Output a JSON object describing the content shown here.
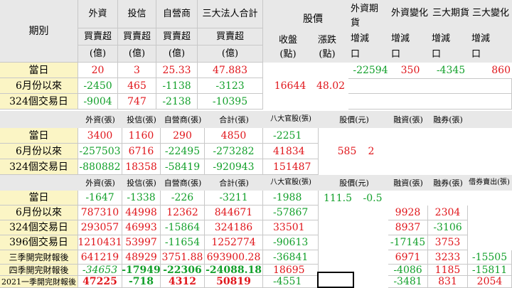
{
  "section1": {
    "header": {
      "period": "期別",
      "foreign": "外資",
      "trust": "投信",
      "dealer": "自營商",
      "total3": "三大法人合計",
      "net_label": "買賣超",
      "unit_label": "(億)",
      "price": "股價",
      "close": "收盤",
      "close_unit": "(點)",
      "change": "漲跌",
      "change_unit": "(點)",
      "fut_foreign_l1": "外資期",
      "fut_foreign_l2": "貨",
      "fut_foreign_change": "外資變化",
      "fut_three": "三大期貨",
      "fut_three_change": "三大變化",
      "incdec": "增減",
      "kou": "口"
    },
    "rows": [
      {
        "label": "當日",
        "foreign": "20",
        "trust": "3",
        "dealer": "25.33",
        "total": "47.883"
      },
      {
        "label": "6月份以來",
        "foreign": "-2450",
        "trust": "465",
        "dealer": "-1138",
        "total": "-3123"
      },
      {
        "label": "324個交易日",
        "foreign": "-9004",
        "trust": "747",
        "dealer": "-2138",
        "total": "-10395"
      }
    ],
    "close_value": "16644",
    "change_value": "48.02",
    "futures": {
      "foreign": "-22594",
      "foreign_change": "350",
      "three": "-4345",
      "three_change": "860"
    }
  },
  "section2": {
    "header": {
      "foreign": "外資(張)",
      "trust": "投信(張)",
      "dealer": "自營商(張)",
      "total": "合計(張)",
      "eight": "八大官股(張)",
      "price": "股價(元)",
      "margin": "融資(張)",
      "short": "融券(張)"
    },
    "rows": [
      {
        "label": "當日",
        "foreign": "3400",
        "trust": "1160",
        "dealer": "290",
        "total": "4850",
        "eight": "-2251"
      },
      {
        "label": "6月份以來",
        "foreign": "-257503",
        "trust": "6716",
        "dealer": "-22495",
        "total": "-273282",
        "eight": "41834"
      },
      {
        "label": "324個交易日",
        "foreign": "-880882",
        "trust": "18358",
        "dealer": "-58419",
        "total": "-920943",
        "eight": "151487"
      }
    ],
    "price_value": "585",
    "price_change": "2"
  },
  "section3": {
    "header": {
      "foreign": "外資(張)",
      "trust": "投信(張)",
      "dealer": "自營商(張)",
      "total": "合計(張)",
      "eight": "八大官股(張)",
      "price": "股價(元)",
      "margin": "融資(張)",
      "short": "融券(張)",
      "lend": "借券賣出(張)"
    },
    "rows": [
      {
        "label": "當日",
        "foreign": "-1647",
        "trust": "-1338",
        "dealer": "-226",
        "total": "-3211",
        "eight": "-1988",
        "price": "111.5",
        "price_change": "-0.5",
        "margin": "",
        "short": "",
        "lend": ""
      },
      {
        "label": "6月份以來",
        "foreign": "787310",
        "trust": "44998",
        "dealer": "12362",
        "total": "844671",
        "eight": "-57867",
        "price": "",
        "price_change": "",
        "margin": "9928",
        "short": "2304",
        "lend": ""
      },
      {
        "label": "324個交易日",
        "foreign": "293057",
        "trust": "46993",
        "dealer": "-15864",
        "total": "324186",
        "eight": "33501",
        "price": "",
        "price_change": "",
        "margin": "8937",
        "short": "-3106",
        "lend": ""
      },
      {
        "label": "396個交易日",
        "foreign": "1210431",
        "trust": "53997",
        "dealer": "-11654",
        "total": "1252774",
        "eight": "-90613",
        "price": "",
        "price_change": "",
        "margin": "-17145",
        "short": "3753",
        "lend": ""
      },
      {
        "label": "三季開完財報後",
        "foreign": "641219",
        "trust": "48929",
        "dealer": "3751.88",
        "total": "693900.28",
        "eight": "-36841",
        "price": "",
        "price_change": "",
        "margin": "6971",
        "short": "3233",
        "lend": "-15505"
      },
      {
        "label": "四季開完財報後",
        "foreign": "-34653",
        "trust": "-17949",
        "dealer": "-22306",
        "total": "-24088.18",
        "eight": "18695",
        "price": "",
        "price_change": "",
        "margin": "-4086",
        "short": "1185",
        "lend": "-15811"
      },
      {
        "label": "2021一季開完財報後",
        "foreign": "47225",
        "trust": "-718",
        "dealer": "4312",
        "total": "50819",
        "eight": "-4551",
        "price": "",
        "price_change": "",
        "margin": "-3481",
        "short": "831",
        "lend": "2054"
      }
    ]
  },
  "colors": {
    "red": "#e0161b",
    "green": "#13a02b",
    "header_gray": "#e8e8e8",
    "label_yellow": "#fbf5c5"
  }
}
